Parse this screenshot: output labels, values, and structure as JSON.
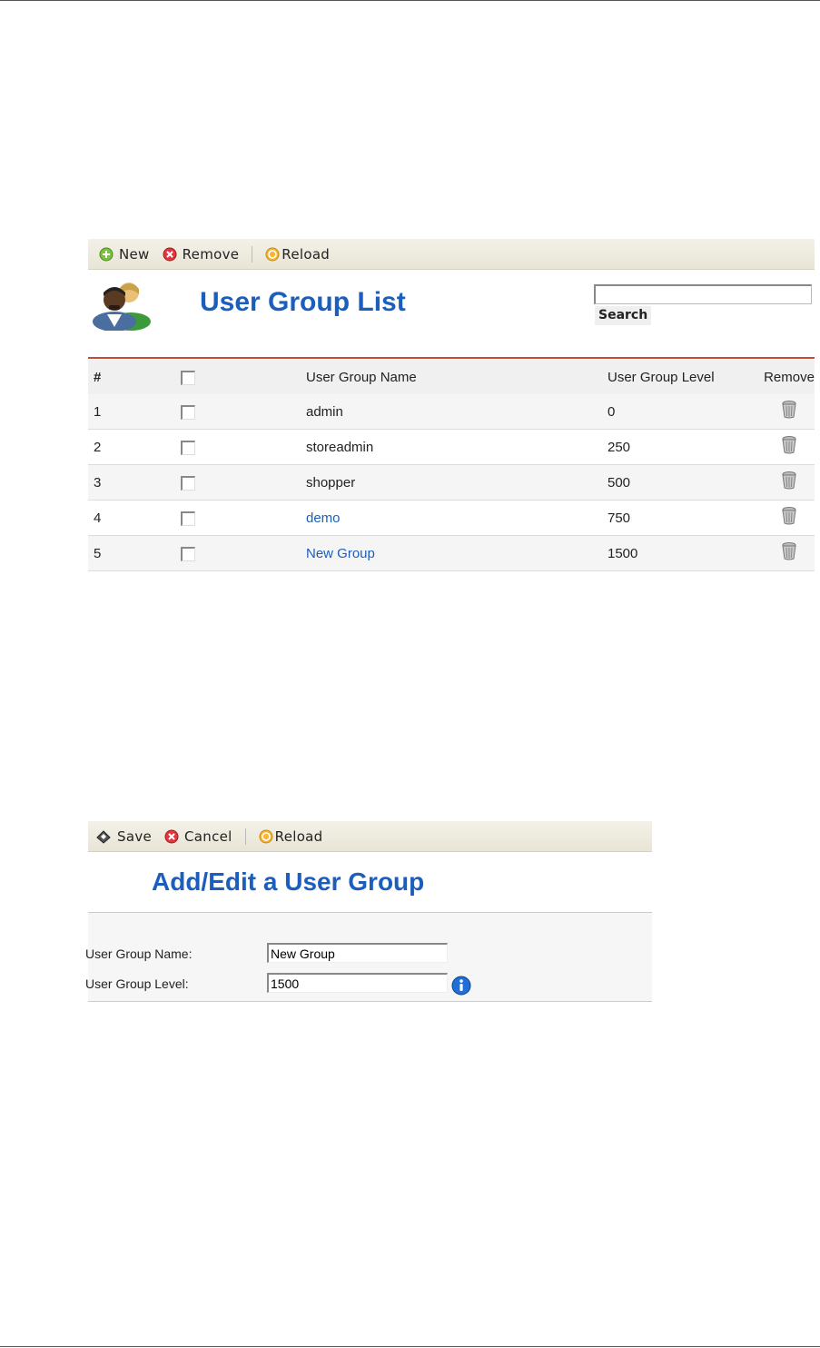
{
  "list_toolbar": {
    "new_label": "New",
    "remove_label": "Remove",
    "reload_label": "Reload"
  },
  "list": {
    "title": "User Group List",
    "search_button": "Search",
    "search_value": "",
    "columns": [
      "#",
      "",
      "User Group Name",
      "User Group Level",
      "Remove"
    ],
    "rows": [
      {
        "num": "1",
        "name": "admin",
        "level": "0",
        "link": false
      },
      {
        "num": "2",
        "name": "storeadmin",
        "level": "250",
        "link": false
      },
      {
        "num": "3",
        "name": "shopper",
        "level": "500",
        "link": false
      },
      {
        "num": "4",
        "name": "demo",
        "level": "750",
        "link": true
      },
      {
        "num": "5",
        "name": "New Group",
        "level": "1500",
        "link": true
      }
    ]
  },
  "form_toolbar": {
    "save_label": "Save",
    "cancel_label": "Cancel",
    "reload_label": "Reload"
  },
  "form": {
    "title": "Add/Edit a User Group",
    "name_label": "User Group Name:",
    "name_value": "New Group",
    "level_label": "User Group Level:",
    "level_value": "1500"
  },
  "icons": {
    "new": "plus-circle-icon",
    "remove": "x-circle-icon",
    "reload": "reload-icon",
    "save": "save-icon",
    "cancel": "x-circle-icon",
    "users": "users-icon",
    "trash": "trash-icon",
    "info": "info-icon"
  },
  "colors": {
    "title_blue": "#1b5ebe",
    "accent_red": "#c8483a",
    "toolbar_bg": "#ebe8da"
  }
}
